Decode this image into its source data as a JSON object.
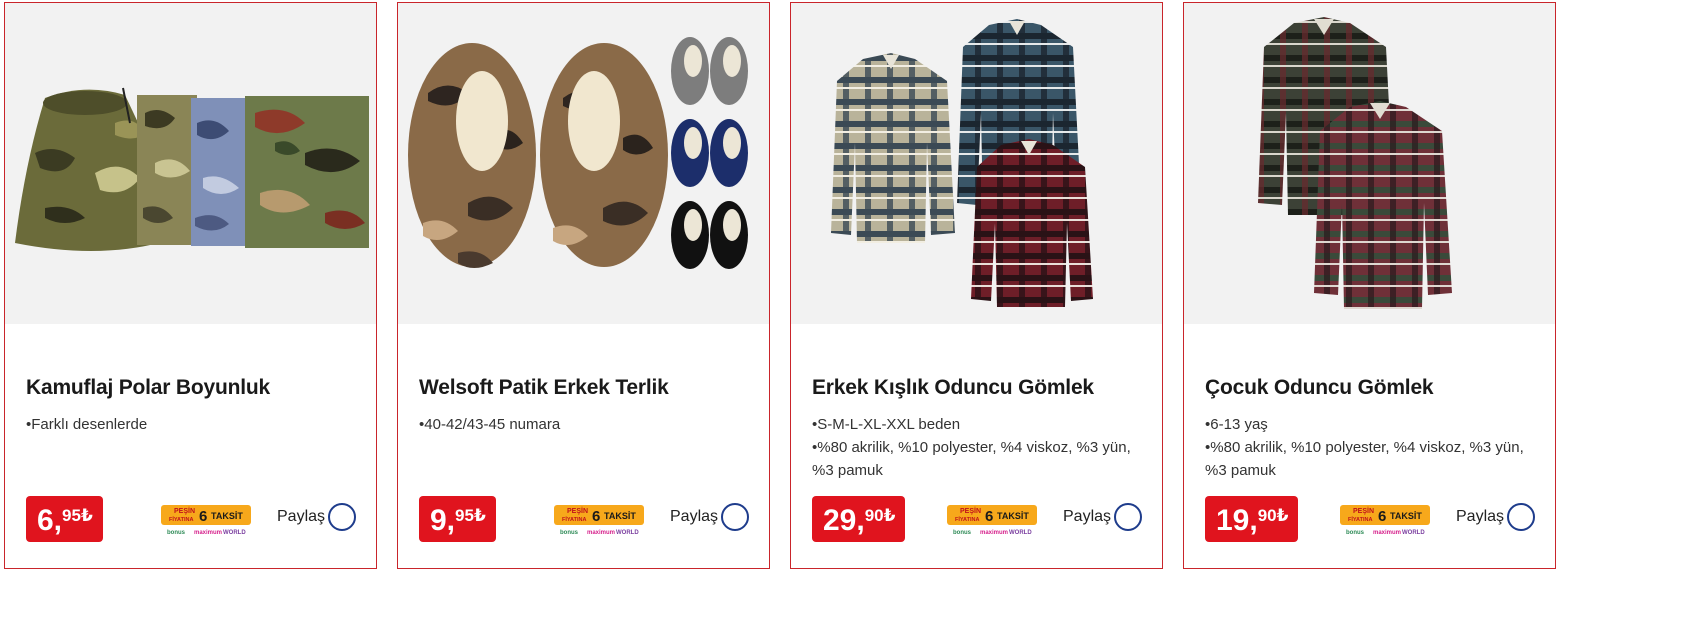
{
  "products": [
    {
      "title": "Kamuflaj Polar Boyunluk",
      "bullets": [
        "Farklı desenlerde"
      ],
      "price_main": "6,",
      "price_cents": "95",
      "currency": "₺",
      "image_icon": "camouflage-neck-warmer-image"
    },
    {
      "title": "Welsoft Patik Erkek Terlik",
      "bullets": [
        "40-42/43-45 numara"
      ],
      "price_main": "9,",
      "price_cents": "95",
      "currency": "₺",
      "image_icon": "slipper-image"
    },
    {
      "title": "Erkek Kışlık Oduncu Gömlek",
      "bullets": [
        "S-M-L-XL-XXL beden",
        "%80 akrilik, %10 polyester, %4 viskoz, %3 yün, %3 pamuk"
      ],
      "price_main": "29,",
      "price_cents": "90",
      "currency": "₺",
      "image_icon": "flannel-shirt-image"
    },
    {
      "title": "Çocuk Oduncu Gömlek",
      "bullets": [
        "6-13 yaş",
        "%80 akrilik, %10 polyester, %4 viskoz, %3 yün, %3 pamuk"
      ],
      "price_main": "19,",
      "price_cents": "90",
      "currency": "₺",
      "image_icon": "flannel-shirt-image"
    }
  ],
  "installment_badge": {
    "line1": "PEŞİN",
    "line2": "FİYATINA",
    "number": "6",
    "word": "TAKSİT",
    "cards": [
      "bonus",
      "maximum",
      "WORLD"
    ]
  },
  "share_label": "Paylaş",
  "colors": {
    "card_border": "#c9252b",
    "price_bg": "#e0141e",
    "badge_bg": "#f7a81b",
    "share_ring": "#1e3c8c"
  }
}
